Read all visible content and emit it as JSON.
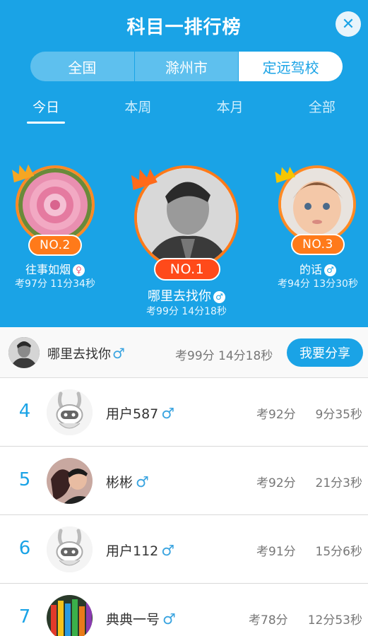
{
  "header": {
    "title": "科目一排行榜",
    "close_icon": "close-icon"
  },
  "scope_tabs": [
    {
      "label": "全国",
      "active": false
    },
    {
      "label": "滁州市",
      "active": false
    },
    {
      "label": "定远驾校",
      "active": true
    }
  ],
  "period_tabs": [
    {
      "label": "今日",
      "active": true
    },
    {
      "label": "本周",
      "active": false
    },
    {
      "label": "本月",
      "active": false
    },
    {
      "label": "全部",
      "active": false
    }
  ],
  "podium": {
    "first": {
      "rank": "NO.1",
      "name": "哪里去找你",
      "gender": "male",
      "gender_symbol": "♂",
      "stat": "考99分 14分18秒",
      "avatar": "portrait-man"
    },
    "second": {
      "rank": "NO.2",
      "name": "往事如烟",
      "gender": "female",
      "gender_symbol": "♀",
      "stat": "考97分 11分34秒",
      "avatar": "pink-flower"
    },
    "third": {
      "rank": "NO.3",
      "name": "的话",
      "gender": "male",
      "gender_symbol": "♂",
      "stat": "考94分 13分30秒",
      "avatar": "baby"
    }
  },
  "my_rank": {
    "name": "哪里去找你",
    "gender_symbol": "♂",
    "stat": "考99分 14分18秒",
    "share_label": "我要分享"
  },
  "list": [
    {
      "rank": "4",
      "name": "用户587",
      "gender_symbol": "♂",
      "score": "考92分",
      "time": "9分35秒",
      "avatar": "default-robot"
    },
    {
      "rank": "5",
      "name": "彬彬",
      "gender_symbol": "♂",
      "score": "考92分",
      "time": "21分3秒",
      "avatar": "couple-photo"
    },
    {
      "rank": "6",
      "name": "用户112",
      "gender_symbol": "♂",
      "score": "考91分",
      "time": "15分6秒",
      "avatar": "default-robot"
    },
    {
      "rank": "7",
      "name": "典典一号",
      "gender_symbol": "♂",
      "score": "考78分",
      "time": "12分53秒",
      "avatar": "color-pencils"
    }
  ],
  "colors": {
    "primary": "#1aa3e6",
    "rank_badge": "#ff7a1a",
    "first_badge": "#ff4a1a",
    "background": "#f2f2f2"
  }
}
